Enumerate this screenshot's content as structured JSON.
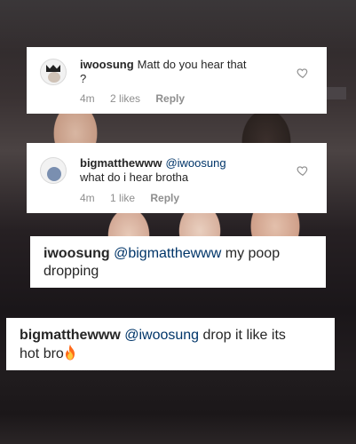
{
  "comments": [
    {
      "username": "iwoosung",
      "text": "Matt do you hear that",
      "text_cont": "?",
      "time": "4m",
      "likes": "2 likes",
      "reply": "Reply",
      "avatar": "crown-avatar-icon"
    },
    {
      "username": "bigmatthewww",
      "mention": "@iwoosung",
      "text": "what do i hear brotha",
      "time": "4m",
      "likes": "1 like",
      "reply": "Reply",
      "avatar": "photo-avatar-icon"
    }
  ],
  "large_comments": [
    {
      "username": "iwoosung",
      "mention": "@bigmatthewww",
      "text_line1": "my poop",
      "text_line2": "dropping"
    },
    {
      "username": "bigmatthewww",
      "mention": "@iwoosung",
      "text_line1": "drop it like its",
      "text_line2": "hot bro",
      "emoji": "fire-emoji-icon"
    }
  ],
  "colors": {
    "username": "#262626",
    "meta": "#8e8e8e",
    "mention": "#003569",
    "card": "#ffffff"
  }
}
